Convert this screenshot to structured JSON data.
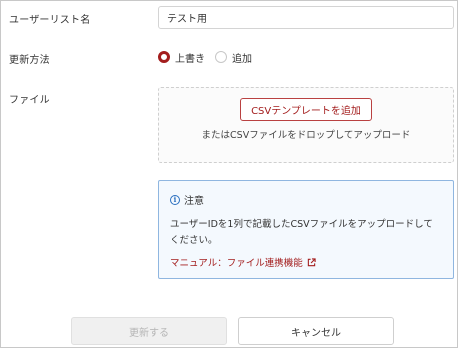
{
  "form": {
    "list_name": {
      "label": "ユーザーリスト名",
      "value": "テスト用"
    },
    "update_method": {
      "label": "更新方法",
      "options": [
        {
          "label": "上書き",
          "selected": true
        },
        {
          "label": "追加",
          "selected": false
        }
      ]
    },
    "file": {
      "label": "ファイル",
      "add_button_label": "CSVテンプレートを追加",
      "drop_hint": "またはCSVファイルをドロップしてアップロード"
    }
  },
  "notice": {
    "icon": "info-icon",
    "title": "注意",
    "body": "ユーザーIDを1列で記載したCSVファイルをアップロードしてください。",
    "link_label": "マニュアル：ファイル連携機能",
    "link_icon": "external-link-icon"
  },
  "actions": {
    "update_label": "更新する",
    "cancel_label": "キャンセル"
  },
  "colors": {
    "accent": "#a31d1d",
    "notice_border": "#8fb6e0",
    "notice_bg": "#f4f9fe",
    "info": "#2a6fbf"
  }
}
